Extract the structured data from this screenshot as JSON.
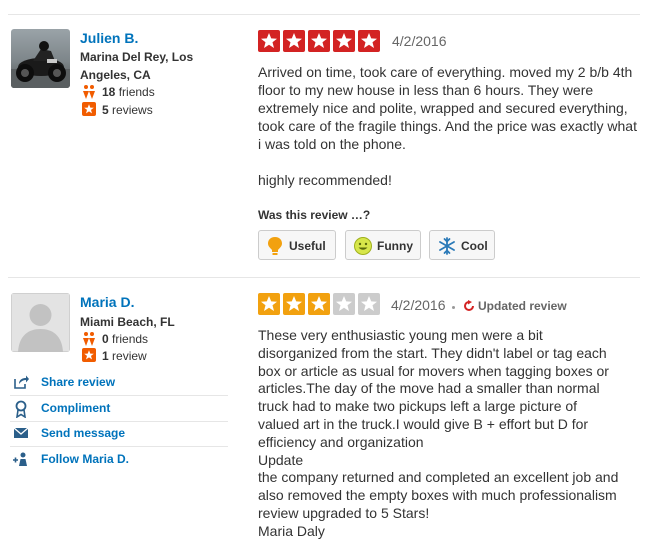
{
  "colors": {
    "star_red": "#d32323",
    "star_orange": "#f2a10f",
    "star_empty": "#ccc",
    "link_blue": "#0073bb",
    "friends_orange": "#f15c00"
  },
  "reviews": [
    {
      "user": {
        "name": "Julien B.",
        "location": "Marina Del Rey, Los Angeles, CA",
        "friends_count": "18",
        "friends_label": "friends",
        "reviews_count": "5",
        "reviews_label": "reviews"
      },
      "rating": 5,
      "date": "4/2/2016",
      "paragraphs": [
        "Arrived on time, took care of everything. moved my 2 b/b 4th floor to my new house in less than 6 hours. They were extremely nice and polite, wrapped and secured everything, took care of the fragile things. And the price was exactly what i was told on the phone.",
        "highly recommended!"
      ],
      "feedback_prompt": "Was this review …?",
      "votes": [
        "Useful",
        "Funny",
        "Cool"
      ]
    },
    {
      "user": {
        "name": "Maria D.",
        "location": "Miami Beach, FL",
        "friends_count": "0",
        "friends_label": "friends",
        "reviews_count": "1",
        "reviews_label": "review"
      },
      "rating": 3,
      "date": "4/2/2016",
      "updated_label": "Updated review",
      "lines": [
        "These very enthusiastic young men were a bit",
        "disorganized from the start. They didn't label or tag each",
        "box or article as usual for movers when tagging boxes or",
        "articles.The day of the move had a smaller than normal",
        "truck had to make two pickups left a large picture of",
        "valued art in the truck.I would give B + effort but D for",
        "efficiency and organization",
        "Update",
        "the company returned and completed an excellent job and",
        "also removed the empty boxes with much professionalism",
        "review upgraded to 5 Stars!",
        "Maria Daly"
      ],
      "actions": [
        "Share review",
        "Compliment",
        "Send message",
        "Follow Maria D."
      ]
    }
  ]
}
